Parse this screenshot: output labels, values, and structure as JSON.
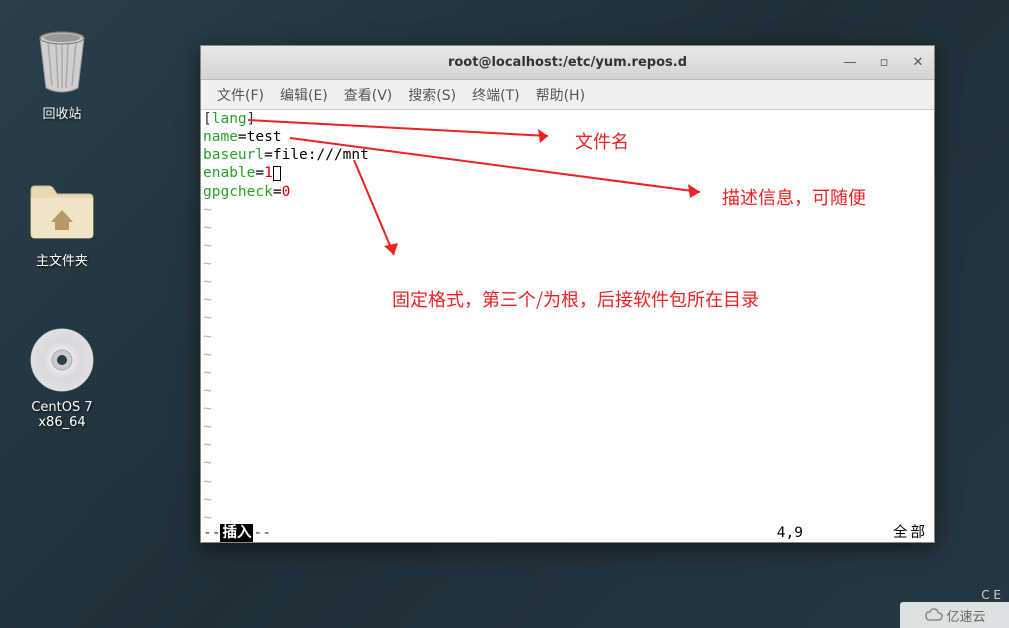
{
  "desktop": {
    "icons": [
      {
        "label": "回收站"
      },
      {
        "label": "主文件夹"
      },
      {
        "label": "CentOS 7 x86_64"
      }
    ]
  },
  "window": {
    "title": "root@localhost:/etc/yum.repos.d",
    "controls": {
      "minimize": "—",
      "maximize": "▫",
      "close": "✕"
    },
    "menu": [
      {
        "label": "文件(F)"
      },
      {
        "label": "编辑(E)"
      },
      {
        "label": "查看(V)"
      },
      {
        "label": "搜索(S)"
      },
      {
        "label": "终端(T)"
      },
      {
        "label": "帮助(H)"
      }
    ]
  },
  "editor": {
    "line1_bracket_open": "[",
    "line1_lang": "lang",
    "line1_bracket_close": "]",
    "line2_key": "name",
    "line2_eq": "=",
    "line2_val": "test",
    "line3_key": "baseurl",
    "line3_eq": "=",
    "line3_val": "file:///mnt",
    "line4_key": "enable",
    "line4_eq": "=",
    "line4_val": "1",
    "line5_key": "gpgcheck",
    "line5_eq": "=",
    "line5_val": "0",
    "tilde": "~",
    "status": {
      "dashes_pre": "-- ",
      "mode": "插入",
      "dashes_post": " --",
      "position": "4,9",
      "all": "全部"
    }
  },
  "annotations": {
    "a1": "文件名",
    "a2": "描述信息，可随便",
    "a3": "固定格式，第三个/为根，后接软件包所在目录"
  },
  "watermark": "亿速云",
  "panel": "C  E"
}
